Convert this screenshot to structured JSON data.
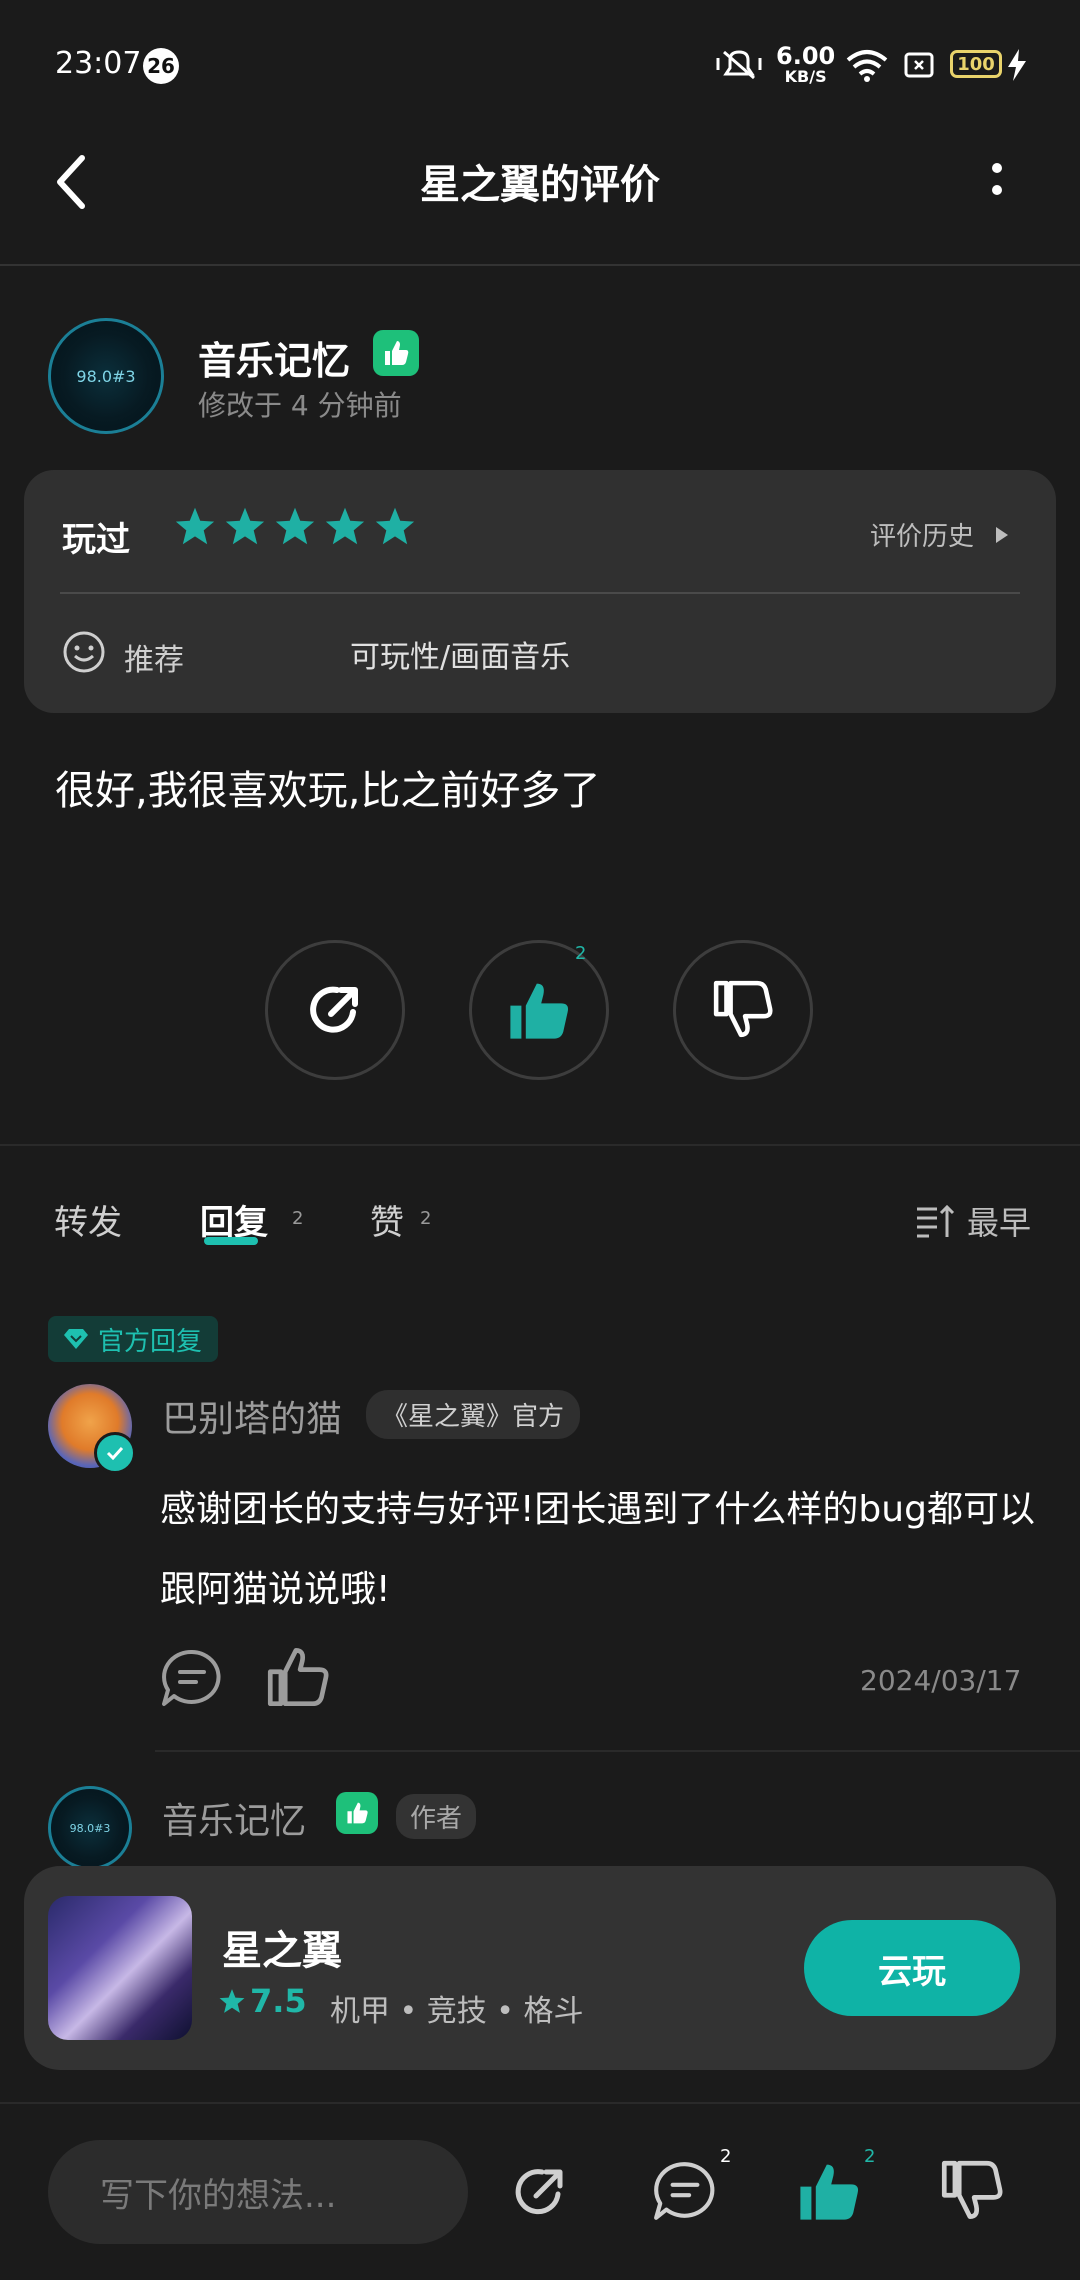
{
  "status": {
    "time": "23:07",
    "notif_count": "26",
    "speed_value": "6.00",
    "speed_unit": "KB/S",
    "battery": "100"
  },
  "header": {
    "title": "星之翼的评价"
  },
  "author": {
    "name": "音乐记忆",
    "modified": "修改于 4 分钟前",
    "avatar_text": "98.0#3"
  },
  "rating_card": {
    "played": "玩过",
    "stars": 5,
    "history": "评价历史",
    "recommend": "推荐",
    "tags": "可玩性/画面音乐"
  },
  "review_text": "很好,我很喜欢玩,比之前好多了",
  "actions": {
    "like_count": "2"
  },
  "tabs": [
    {
      "label": "转发",
      "count": ""
    },
    {
      "label": "回复",
      "count": "2"
    },
    {
      "label": "赞",
      "count": "2"
    }
  ],
  "sort_label": "最早",
  "official_reply": {
    "tag": "官方回复",
    "name": "巴别塔的猫",
    "org_tag": "《星之翼》官方",
    "text": "感谢团长的支持与好评!团长遇到了什么样的bug都可以跟阿猫说说哦!",
    "date": "2024/03/17"
  },
  "second_reply": {
    "name": "音乐记忆",
    "author_tag": "作者"
  },
  "game": {
    "name": "星之翼",
    "score": "7.5",
    "tags": "机甲 • 竞技 • 格斗",
    "button": "云玩"
  },
  "bottom_bar": {
    "placeholder": "写下你的想法...",
    "reply_count": "2",
    "like_count": "2"
  },
  "colors": {
    "accent": "#0fb3a6",
    "background": "#1b1b1b",
    "card": "#303030",
    "badge_green": "#1ec07a"
  }
}
